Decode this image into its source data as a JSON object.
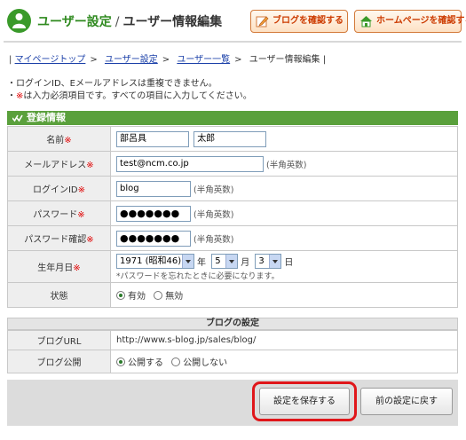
{
  "header": {
    "title": "ユーザー設定",
    "separator": "/",
    "subtitle": "ユーザー情報編集",
    "blog_button": "ブログを確認する",
    "home_button": "ホームページを確認する"
  },
  "breadcrumb": {
    "open": "|",
    "items": [
      "マイページトップ",
      "ユーザー設定",
      "ユーザー一覧"
    ],
    "gt": ">",
    "current": "ユーザー情報編集",
    "close": "|"
  },
  "notes": {
    "line1": "・ログインID、Eメールアドレスは重複できません。",
    "line2_prefix": "・",
    "line2_mark": "※",
    "line2_text": "は入力必須項目です。すべての項目に入力してください。"
  },
  "required_mark": "※",
  "section_title": "登録情報",
  "form": {
    "name": {
      "label": "名前",
      "last": "部呂具",
      "first": "太郎"
    },
    "email": {
      "label": "メールアドレス",
      "value": "test@ncm.co.jp",
      "hint": "(半角英数)"
    },
    "login_id": {
      "label": "ログインID",
      "value": "blog",
      "hint": "(半角英数)"
    },
    "password": {
      "label": "パスワード",
      "value": "●●●●●●●",
      "hint": "(半角英数)"
    },
    "password_confirm": {
      "label": "パスワード確認",
      "value": "●●●●●●●",
      "hint": "(半角英数)"
    },
    "birthday": {
      "label": "生年月日",
      "year": "1971 (昭和46)",
      "year_unit": "年",
      "month": "5",
      "month_unit": "月",
      "day": "3",
      "day_unit": "日",
      "note": "*パスワードを忘れたときに必要になります。"
    },
    "status": {
      "label": "状態",
      "options": [
        "有効",
        "無効"
      ],
      "selected": "有効"
    }
  },
  "blog_settings": {
    "title": "ブログの設定",
    "url_label": "ブログURL",
    "url_value": "http://www.s-blog.jp/sales/blog/",
    "public_label": "ブログ公開",
    "options": [
      "公開する",
      "公開しない"
    ],
    "selected": "公開する"
  },
  "buttons": {
    "save": "設定を保存する",
    "back": "前の設定に戻す"
  },
  "colors": {
    "brand_green": "#3a9a2a",
    "section_green": "#5aa03c",
    "highlight_red": "#e0161a",
    "required_red": "#e00000"
  }
}
